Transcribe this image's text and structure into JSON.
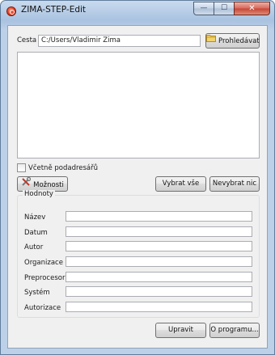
{
  "window": {
    "title": "ZIMA-STEP-Edit"
  },
  "title_controls": {
    "minimize": "—",
    "maximize": "☐",
    "close": "✕"
  },
  "path": {
    "label": "Cesta",
    "value": "C:/Users/Vladimir Zima",
    "browse_label": "Prohledávat"
  },
  "include_subfolders": {
    "label": "Včetně podadresářů",
    "checked": false
  },
  "buttons": {
    "options": "Možnosti",
    "select_all": "Vybrat vše",
    "deselect_all": "Nevybrat nic",
    "edit": "Upravit",
    "about": "O programu..."
  },
  "values_group": {
    "title": "Hodnoty",
    "fields": [
      {
        "label": "Název",
        "value": ""
      },
      {
        "label": "Datum",
        "value": ""
      },
      {
        "label": "Autor",
        "value": ""
      },
      {
        "label": "Organizace",
        "value": ""
      },
      {
        "label": "Preprocesor",
        "value": ""
      },
      {
        "label": "Systém",
        "value": ""
      },
      {
        "label": "Autorizace",
        "value": ""
      }
    ]
  }
}
